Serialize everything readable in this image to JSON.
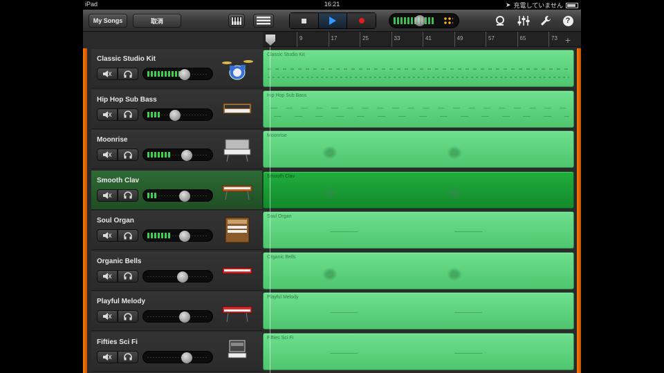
{
  "status_bar": {
    "device": "iPad",
    "time": "16:21",
    "charging_text": "充電していません"
  },
  "toolbar": {
    "my_songs": "My Songs",
    "undo": "取消",
    "keys_view_icon": "piano-keys-icon",
    "tracks_view_icon": "tracks-list-icon",
    "loop_icon": "loop-browser-icon",
    "mixer_icon": "mixer-sliders-icon",
    "wrench_icon": "wrench-icon",
    "help_label": "?"
  },
  "ruler": {
    "markers": [
      "9",
      "17",
      "25",
      "33",
      "41",
      "49",
      "57",
      "65",
      "73"
    ]
  },
  "colors": {
    "region": "#5fd47e",
    "region_selected": "#179c34",
    "accent_orange": "#ff7a00"
  },
  "tracks": [
    {
      "name": "Classic Studio Kit",
      "region_label": "Classic Studio Kit",
      "level": 0.75,
      "knob": 0.62,
      "selected": false,
      "instrument_icon": "drum-kit-icon",
      "notes": "dense"
    },
    {
      "name": "Hip Hop Sub Bass",
      "region_label": "Hip Hop Sub Bass",
      "level": 0.3,
      "knob": 0.45,
      "selected": false,
      "instrument_icon": "synth-keyboard-icon",
      "notes": "bass"
    },
    {
      "name": "Moonrise",
      "region_label": "Moonrise",
      "level": 0.55,
      "knob": 0.65,
      "selected": false,
      "instrument_icon": "electric-piano-icon",
      "notes": "chords"
    },
    {
      "name": "Smooth Clav",
      "region_label": "Smooth Clav",
      "level": 0.2,
      "knob": 0.62,
      "selected": true,
      "instrument_icon": "clavinet-icon",
      "notes": "chords"
    },
    {
      "name": "Soul Organ",
      "region_label": "Soul Organ",
      "level": 0.55,
      "knob": 0.62,
      "selected": false,
      "instrument_icon": "organ-icon",
      "notes": "sparse"
    },
    {
      "name": "Organic Bells",
      "region_label": "Organic Bells",
      "level": 0.0,
      "knob": 0.58,
      "selected": false,
      "instrument_icon": "red-keyboard-icon",
      "notes": "chords"
    },
    {
      "name": "Playful Melody",
      "region_label": "Playful Melody",
      "level": 0.0,
      "knob": 0.62,
      "selected": false,
      "instrument_icon": "red-synth-icon",
      "notes": "sparse"
    },
    {
      "name": "Fifties Sci Fi",
      "region_label": "Fifties Sci Fi",
      "level": 0.0,
      "knob": 0.65,
      "selected": false,
      "instrument_icon": "vintage-synth-icon",
      "notes": "sparse"
    }
  ]
}
